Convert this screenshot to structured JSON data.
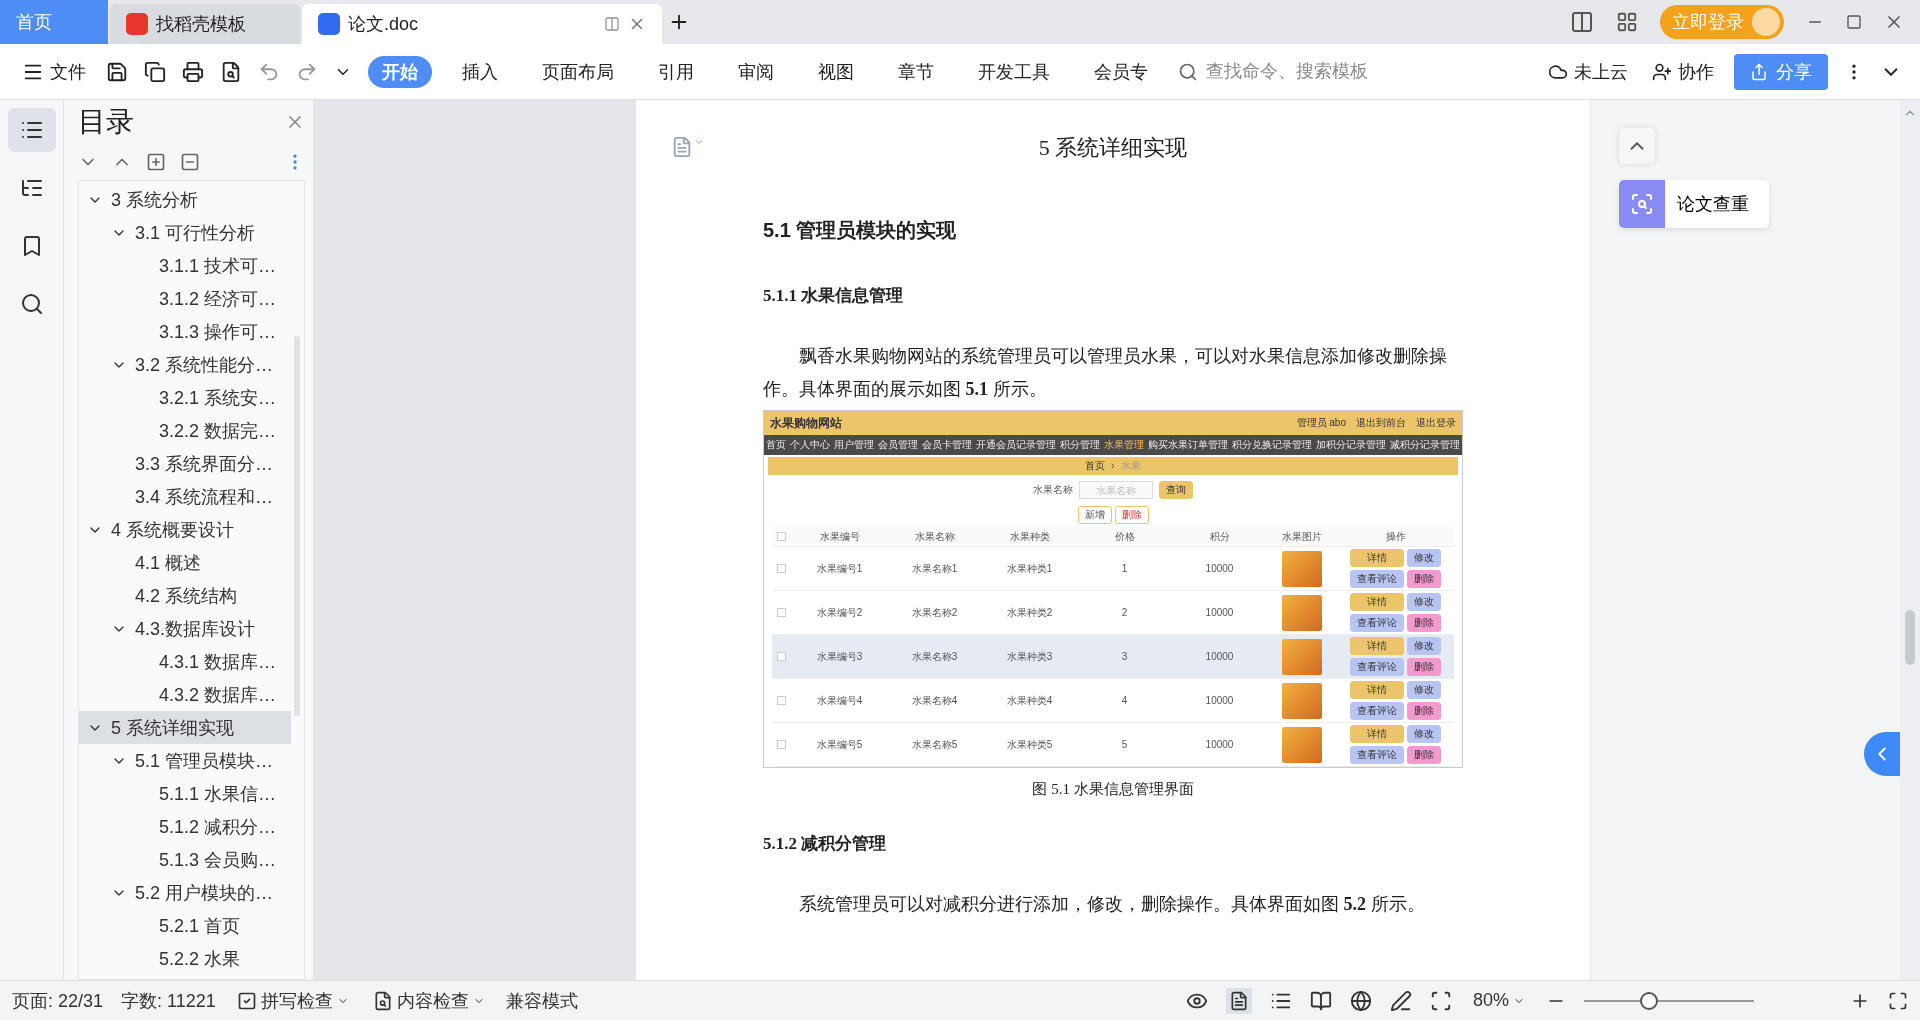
{
  "title_bar": {
    "tabs": [
      {
        "label": "首页",
        "kind": "home",
        "selected": false
      },
      {
        "label": "找稻壳模板",
        "kind": "docer",
        "selected": false
      },
      {
        "label": "论文.doc",
        "kind": "doc",
        "selected": true
      }
    ],
    "login_button": "立即登录"
  },
  "toolbar": {
    "file_menu": "文件",
    "menu_tabs": [
      {
        "label": "开始",
        "selected": true
      },
      {
        "label": "插入",
        "selected": false
      },
      {
        "label": "页面布局",
        "selected": false
      },
      {
        "label": "引用",
        "selected": false
      },
      {
        "label": "审阅",
        "selected": false
      },
      {
        "label": "视图",
        "selected": false
      },
      {
        "label": "章节",
        "selected": false
      },
      {
        "label": "开发工具",
        "selected": false
      },
      {
        "label": "会员专",
        "selected": false
      }
    ],
    "search": {
      "placeholder": "查找命令、搜索模板"
    },
    "cloud_status": "未上云",
    "collaborate": "协作",
    "share": "分享"
  },
  "sidebar": {
    "icons": [
      {
        "kind": "toc",
        "selected": true
      },
      {
        "kind": "outline",
        "selected": false
      },
      {
        "kind": "bookmark",
        "selected": false
      },
      {
        "kind": "search",
        "selected": false
      }
    ]
  },
  "toc": {
    "title": "目录",
    "items": [
      {
        "label": "3 系统分析",
        "selected": false,
        "expanded": true,
        "children": [
          {
            "label": "3.1 可行性分析",
            "selected": false,
            "expanded": true,
            "children": [
              {
                "label": "3.1.1 技术可…",
                "selected": false
              },
              {
                "label": "3.1.2 经济可…",
                "selected": false
              },
              {
                "label": "3.1.3 操作可…",
                "selected": false
              }
            ]
          },
          {
            "label": "3.2 系统性能分…",
            "selected": false,
            "expanded": true,
            "children": [
              {
                "label": "3.2.1  系统安…",
                "selected": false
              },
              {
                "label": "3.2.2  数据完…",
                "selected": false
              }
            ]
          },
          {
            "label": "3.3 系统界面分…",
            "selected": false
          },
          {
            "label": "3.4 系统流程和…",
            "selected": false
          }
        ]
      },
      {
        "label": "4 系统概要设计",
        "selected": false,
        "expanded": true,
        "children": [
          {
            "label": "4.1 概述",
            "selected": false
          },
          {
            "label": "4.2 系统结构",
            "selected": false
          },
          {
            "label": "4.3.数据库设计",
            "selected": false,
            "expanded": true,
            "children": [
              {
                "label": "4.3.1 数据库…",
                "selected": false
              },
              {
                "label": "4.3.2 数据库…",
                "selected": false
              }
            ]
          }
        ]
      },
      {
        "label": "5 系统详细实现",
        "selected": true,
        "expanded": true,
        "children": [
          {
            "label": "5.1  管理员模块…",
            "selected": false,
            "expanded": true,
            "children": [
              {
                "label": "5.1.1  水果信…",
                "selected": false
              },
              {
                "label": "5.1.2  减积分…",
                "selected": false
              },
              {
                "label": "5.1.3  会员购…",
                "selected": false
              }
            ]
          },
          {
            "label": "5.2  用户模块的…",
            "selected": false,
            "expanded": true,
            "children": [
              {
                "label": "5.2.1  首页",
                "selected": false
              },
              {
                "label": "5.2.2  水果",
                "selected": false
              }
            ]
          }
        ]
      }
    ]
  },
  "document": {
    "chapter_title": "5 系统详细实现",
    "section_title": "5.1  管理员模块的实现",
    "subsection_title": "5.1.1  水果信息管理",
    "paragraph": "飘香水果购物网站的系统管理员可以管理员水果，可以对水果信息添加修改删除操作。具体界面的展示如图 **5.1** 所示。",
    "figure": {
      "app_title": "水果购物网站",
      "user": "管理员 abo",
      "header_links": [
        "退出到前台",
        "退出登录"
      ],
      "nav": [
        {
          "label": "首页",
          "selected": false
        },
        {
          "label": "个人中心",
          "selected": false
        },
        {
          "label": "用户管理",
          "selected": false
        },
        {
          "label": "会员管理",
          "selected": false
        },
        {
          "label": "会员卡管理",
          "selected": false
        },
        {
          "label": "开通会员记录管理",
          "selected": false
        },
        {
          "label": "积分管理",
          "selected": false
        },
        {
          "label": "水果管理",
          "selected": true
        },
        {
          "label": "购买水果订单管理",
          "selected": false
        },
        {
          "label": "积分兑换记录管理",
          "selected": false
        },
        {
          "label": "加积分记录管理",
          "selected": false
        },
        {
          "label": "减积分记录管理",
          "selected": false
        }
      ],
      "breadcrumb": [
        "首页",
        "水果"
      ],
      "search_label": "水果名称",
      "search_placeholder": "水果名称",
      "search_button": "查询",
      "add_button": "新增",
      "delete_button": "删除",
      "header_checked": false,
      "columns": [
        "水果编号",
        "水果名称",
        "水果种类",
        "价格",
        "积分",
        "水果图片",
        "操作"
      ],
      "rows": [
        {
          "cells": [
            "水果编号1",
            "水果名称1",
            "水果种类1",
            "1",
            "10000"
          ],
          "hovered": false,
          "checked": false,
          "actions": [
            "详情",
            "修改",
            "查看评论",
            "删除"
          ]
        },
        {
          "cells": [
            "水果编号2",
            "水果名称2",
            "水果种类2",
            "2",
            "10000"
          ],
          "hovered": false,
          "checked": false,
          "actions": [
            "详情",
            "修改",
            "查看评论",
            "删除"
          ]
        },
        {
          "cells": [
            "水果编号3",
            "水果名称3",
            "水果种类3",
            "3",
            "10000"
          ],
          "hovered": true,
          "checked": false,
          "actions": [
            "详情",
            "修改",
            "查看评论",
            "删除"
          ]
        },
        {
          "cells": [
            "水果编号4",
            "水果名称4",
            "水果种类4",
            "4",
            "10000"
          ],
          "hovered": false,
          "checked": false,
          "actions": [
            "详情",
            "修改",
            "查看评论",
            "删除"
          ]
        },
        {
          "cells": [
            "水果编号5",
            "水果名称5",
            "水果种类5",
            "5",
            "10000"
          ],
          "hovered": false,
          "checked": false,
          "actions": [
            "详情",
            "修改",
            "查看评论",
            "删除"
          ]
        }
      ],
      "caption": "图 5.1  水果信息管理界面"
    },
    "subsection_title_2": "5.1.2  减积分管理",
    "paragraph_2": "系统管理员可以对减积分进行添加，修改，删除操作。具体界面如图 **5.2** 所示。"
  },
  "side_panel": {
    "plagiarism_check": "论文查重"
  },
  "status_bar": {
    "page": "页面: 22/31",
    "word_count": "字数: 11221",
    "spell_check": "拼写检查",
    "content_check": "内容检查",
    "mode": "兼容模式",
    "zoom": "80%",
    "zoom_slider": {
      "level": 0.38
    }
  }
}
